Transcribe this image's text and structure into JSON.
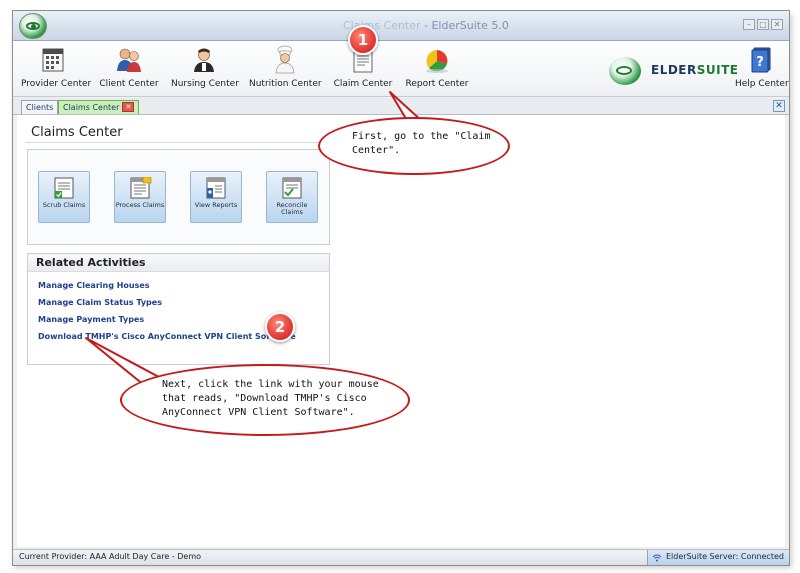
{
  "window": {
    "title": "Claims Center - ElderSuite 5.0",
    "title_ghost": "Claims Center",
    "title_suffix": " - ElderSuite 5.0",
    "min_glyph": "–",
    "max_glyph": "□",
    "close_glyph": "✕"
  },
  "ribbon": {
    "items": [
      {
        "label": "Provider Center",
        "icon": "building-calendar-icon"
      },
      {
        "label": "Client Center",
        "icon": "people-icon"
      },
      {
        "label": "Nursing Center",
        "icon": "nurse-icon"
      },
      {
        "label": "Nutrition Center",
        "icon": "chef-icon"
      },
      {
        "label": "Claim Center",
        "icon": "claim-document-icon"
      },
      {
        "label": "Report Center",
        "icon": "pie-chart-icon"
      },
      {
        "label": "Help Center",
        "icon": "help-book-icon"
      }
    ],
    "brand_part1": "ELDER",
    "brand_part2": "SUITE"
  },
  "tabs": [
    {
      "label": "Clients",
      "active": false
    },
    {
      "label": "Claims Center",
      "active": true
    }
  ],
  "tab_close_glyph": "✕",
  "strip_close_glyph": "✕",
  "page": {
    "title": "Claims Center",
    "tiles": [
      {
        "label": "Scrub Claims"
      },
      {
        "label": "Process Claims"
      },
      {
        "label": "View Reports"
      },
      {
        "label_line1": "Reconcile",
        "label_line2": "Claims"
      }
    ],
    "related": {
      "heading": "Related Activities",
      "links": [
        "Manage Clearing Houses",
        "Manage Claim Status Types",
        "Manage Payment Types",
        "Download TMHP's Cisco AnyConnect VPN Client Software"
      ]
    }
  },
  "status": {
    "provider": "Current Provider: AAA Adult Day Care - Demo",
    "server": "ElderSuite Server: Connected"
  },
  "annotations": {
    "badge1": "1",
    "badge2": "2",
    "callout1_line1": "First, go to the \"Claim",
    "callout1_line2": "Center\".",
    "callout2_line1": "Next, click the link with your mouse",
    "callout2_line2": "that reads, \"Download TMHP's Cisco",
    "callout2_line3": "AnyConnect VPN Client Software\"."
  },
  "colors": {
    "accent_red": "#c41a1a",
    "link_blue": "#1f3f8f",
    "brand_green": "#1d7a36",
    "active_tab_green": "#c9f0b8"
  }
}
